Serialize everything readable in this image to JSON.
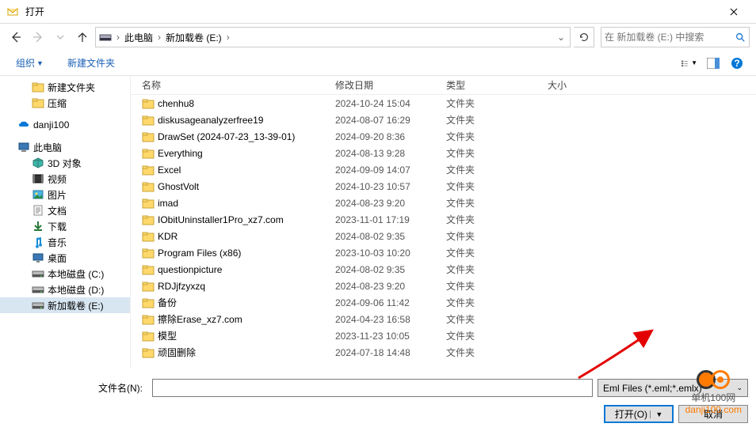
{
  "title": "打开",
  "breadcrumb": {
    "seg1": "此电脑",
    "seg2": "新加载卷 (E:)"
  },
  "search": {
    "placeholder": "在 新加载卷 (E:) 中搜索"
  },
  "toolbar": {
    "organize": "组织",
    "newfolder": "新建文件夹"
  },
  "columns": {
    "name": "名称",
    "date": "修改日期",
    "type": "类型",
    "size": "大小"
  },
  "sidebar": [
    {
      "label": "新建文件夹",
      "indent": 28,
      "icon": "folder"
    },
    {
      "label": "压缩",
      "indent": 28,
      "icon": "folder"
    },
    {
      "label": "",
      "indent": 0,
      "icon": "none"
    },
    {
      "label": "danji100",
      "indent": 10,
      "icon": "onedrive"
    },
    {
      "label": "",
      "indent": 0,
      "icon": "none"
    },
    {
      "label": "此电脑",
      "indent": 10,
      "icon": "pc"
    },
    {
      "label": "3D 对象",
      "indent": 28,
      "icon": "3d"
    },
    {
      "label": "视频",
      "indent": 28,
      "icon": "video"
    },
    {
      "label": "图片",
      "indent": 28,
      "icon": "pictures"
    },
    {
      "label": "文档",
      "indent": 28,
      "icon": "docs"
    },
    {
      "label": "下载",
      "indent": 28,
      "icon": "downloads"
    },
    {
      "label": "音乐",
      "indent": 28,
      "icon": "music"
    },
    {
      "label": "桌面",
      "indent": 28,
      "icon": "desktop"
    },
    {
      "label": "本地磁盘 (C:)",
      "indent": 28,
      "icon": "disk"
    },
    {
      "label": "本地磁盘 (D:)",
      "indent": 28,
      "icon": "disk"
    },
    {
      "label": "新加载卷 (E:)",
      "indent": 28,
      "icon": "disk",
      "selected": true
    }
  ],
  "files": [
    {
      "name": "chenhu8",
      "date": "2024-10-24 15:04",
      "type": "文件夹"
    },
    {
      "name": "diskusageanalyzerfree19",
      "date": "2024-08-07 16:29",
      "type": "文件夹"
    },
    {
      "name": "DrawSet (2024-07-23_13-39-01)",
      "date": "2024-09-20 8:36",
      "type": "文件夹"
    },
    {
      "name": "Everything",
      "date": "2024-08-13 9:28",
      "type": "文件夹"
    },
    {
      "name": "Excel",
      "date": "2024-09-09 14:07",
      "type": "文件夹"
    },
    {
      "name": "GhostVolt",
      "date": "2024-10-23 10:57",
      "type": "文件夹"
    },
    {
      "name": "imad",
      "date": "2024-08-23 9:20",
      "type": "文件夹"
    },
    {
      "name": "IObitUninstaller1Pro_xz7.com",
      "date": "2023-11-01 17:19",
      "type": "文件夹"
    },
    {
      "name": "KDR",
      "date": "2024-08-02 9:35",
      "type": "文件夹"
    },
    {
      "name": "Program Files (x86)",
      "date": "2023-10-03 10:20",
      "type": "文件夹"
    },
    {
      "name": "questionpicture",
      "date": "2024-08-02 9:35",
      "type": "文件夹"
    },
    {
      "name": "RDJjfzyxzq",
      "date": "2024-08-23 9:20",
      "type": "文件夹"
    },
    {
      "name": "备份",
      "date": "2024-09-06 11:42",
      "type": "文件夹"
    },
    {
      "name": "擦除Erase_xz7.com",
      "date": "2024-04-23 16:58",
      "type": "文件夹"
    },
    {
      "name": "模型",
      "date": "2023-11-23 10:05",
      "type": "文件夹"
    },
    {
      "name": "顽固删除",
      "date": "2024-07-18 14:48",
      "type": "文件夹"
    }
  ],
  "footer": {
    "filenameLabel": "文件名(N):",
    "filter": "Eml Files (*.eml;*.emlx)",
    "open": "打开(O)",
    "cancel": "取消"
  },
  "watermark": {
    "line1": "单机100网",
    "line2": "danji100.com"
  }
}
